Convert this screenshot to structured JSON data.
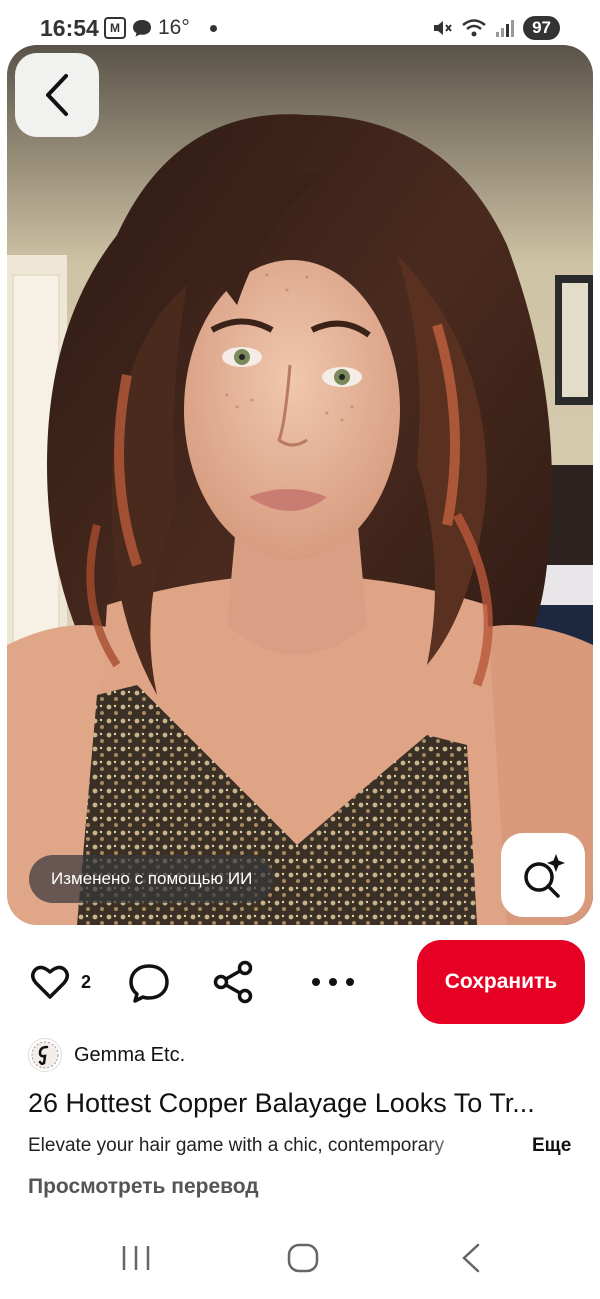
{
  "status_bar": {
    "time": "16:54",
    "temperature": "16°",
    "battery": "97",
    "icons": [
      "app-m-icon",
      "chat-bubble-icon",
      "mute-icon",
      "wifi-icon",
      "signal-icon"
    ]
  },
  "pin": {
    "image_desc_icon": "photo",
    "ai_badge": "Изменено с помощью ИИ",
    "like_count": "2",
    "save_label": "Сохранить",
    "author_name": "Gemma Etc.",
    "title": "26 Hottest Copper Balayage Looks To Tr...",
    "description": "Elevate your hair game with a chic, contemporary",
    "more_label": "Еще",
    "translate_label": "Просмотреть перевод"
  },
  "colors": {
    "accent": "#e60023",
    "text": "#111111",
    "muted": "#555555"
  }
}
